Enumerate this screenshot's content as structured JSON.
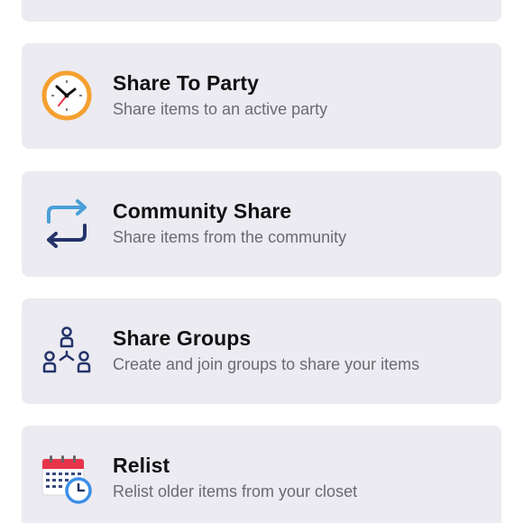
{
  "items": [
    {
      "title": "Share To Party",
      "subtitle": "Share items to an active party",
      "icon": "clock-icon"
    },
    {
      "title": "Community Share",
      "subtitle": "Share items from the community",
      "icon": "repeat-arrows-icon"
    },
    {
      "title": "Share Groups",
      "subtitle": "Create and join groups to share your items",
      "icon": "group-network-icon"
    },
    {
      "title": "Relist",
      "subtitle": "Relist older items from your closet",
      "icon": "calendar-clock-icon"
    }
  ],
  "colors": {
    "card_background": "#ebebf1",
    "title_text": "#111111",
    "subtitle_text": "#6a6a70",
    "clock_ring": "#f5a030",
    "arrow_light_blue": "#4a9fd8",
    "arrow_dark_blue": "#24346a",
    "calendar_red": "#e8344a",
    "calendar_clock_blue": "#3a8ee6"
  }
}
